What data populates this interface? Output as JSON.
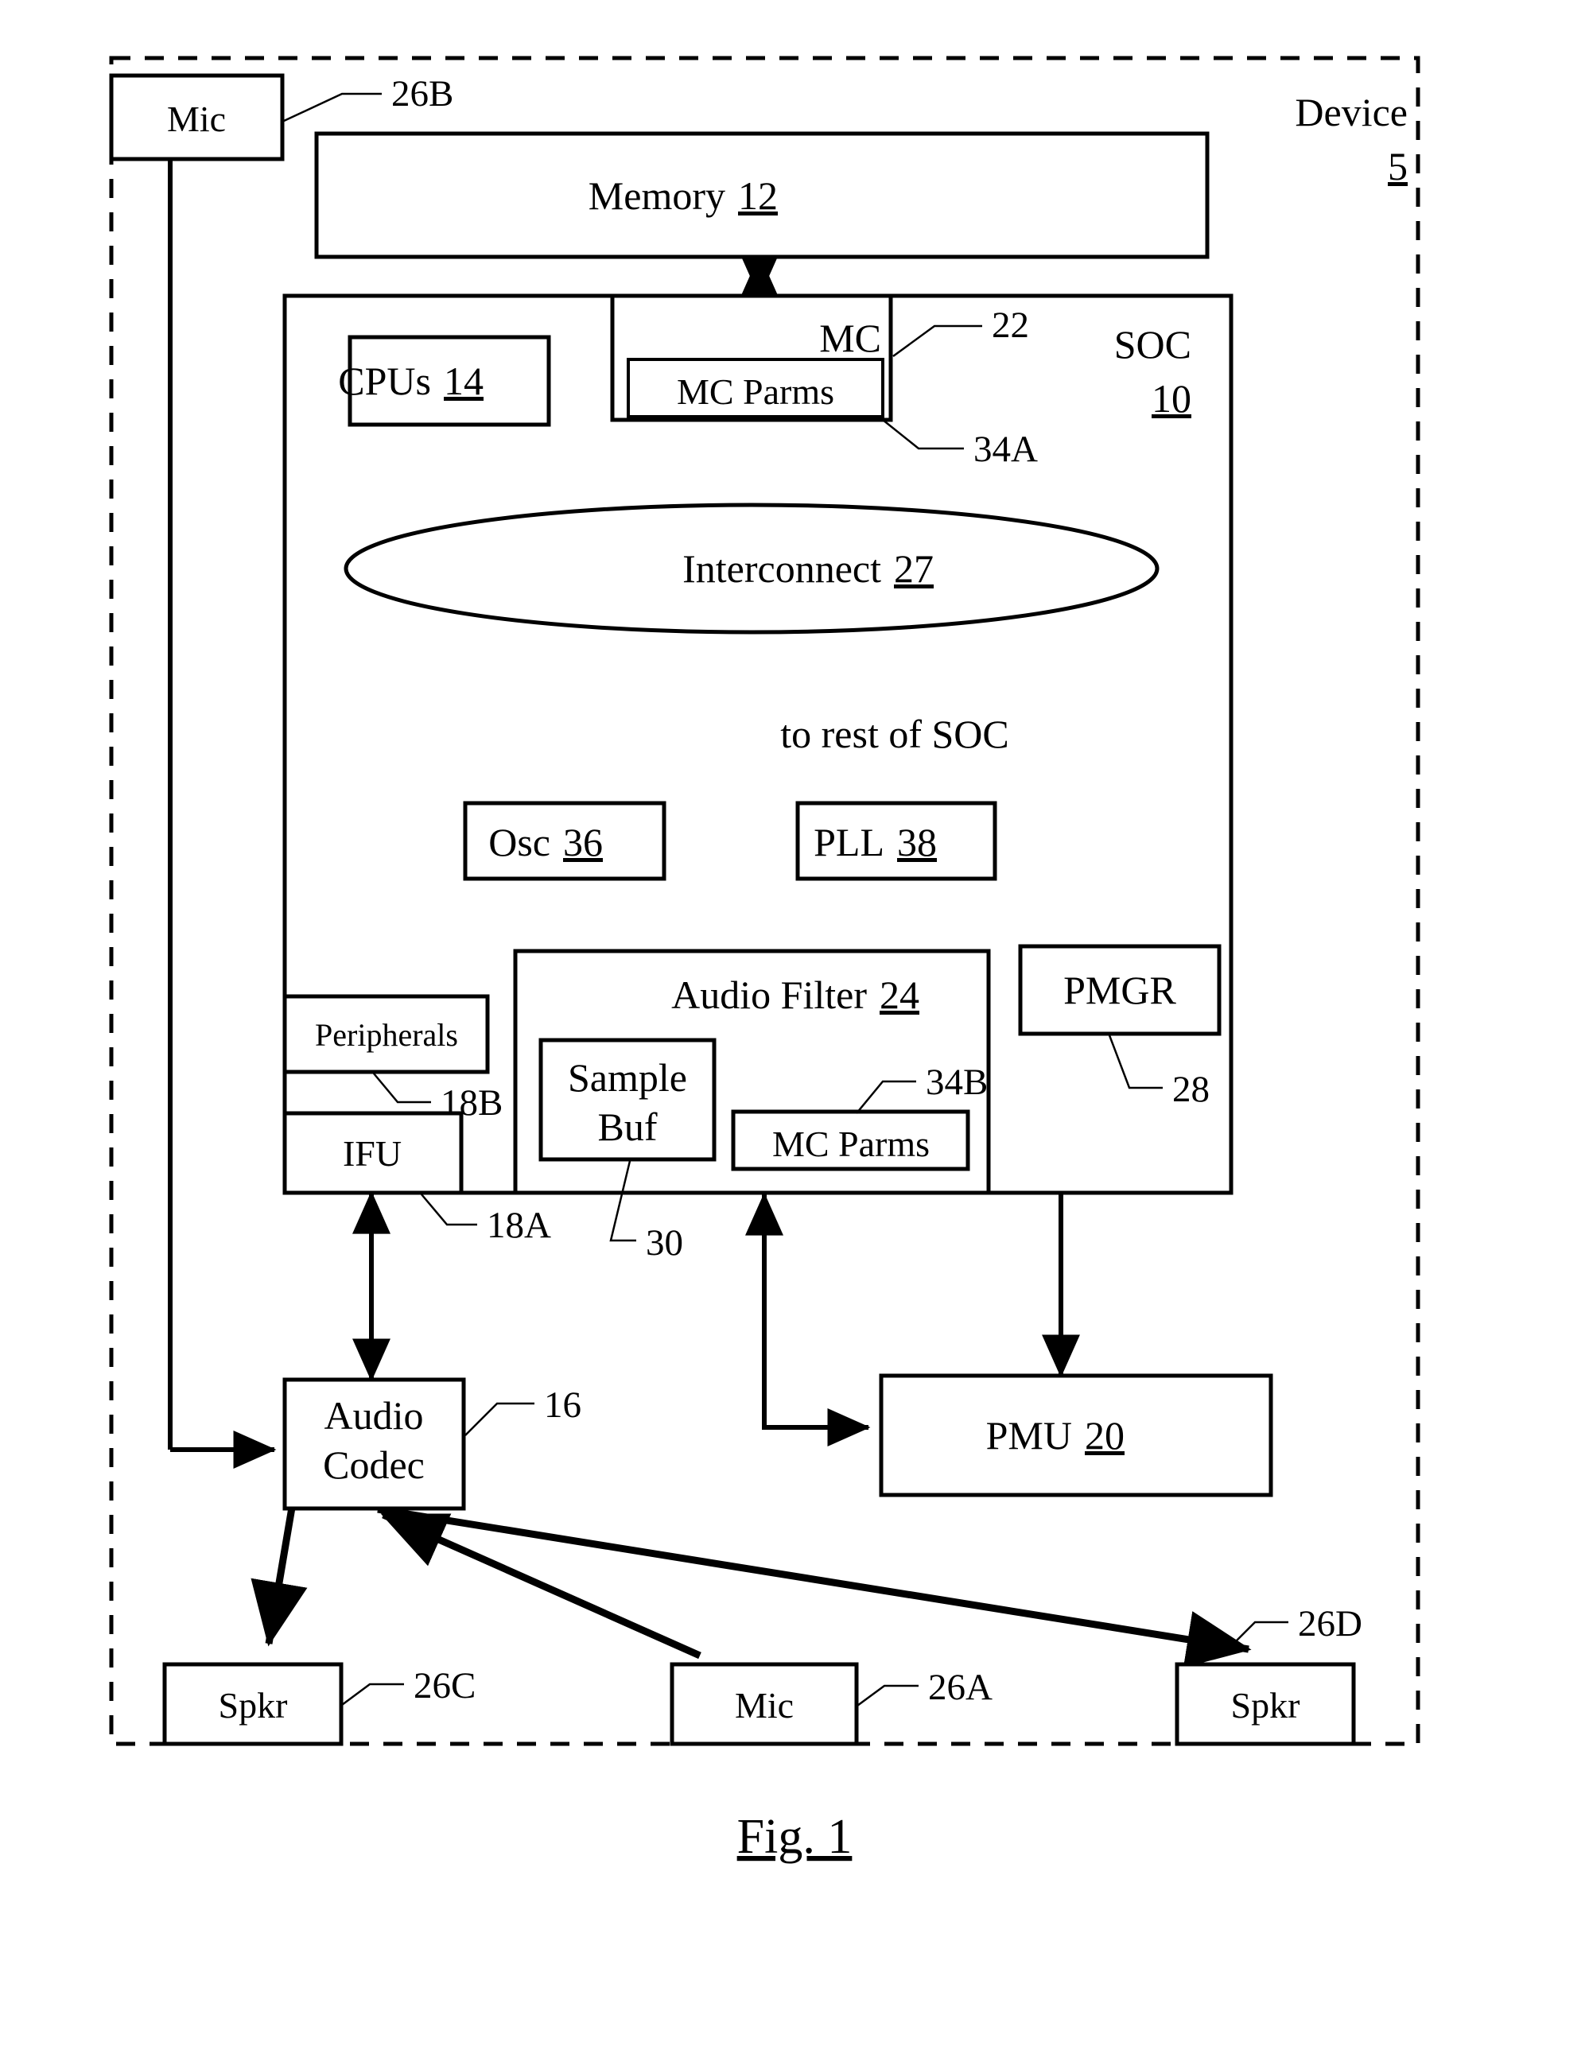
{
  "figure": {
    "caption": "Fig. 1",
    "device_label": "Device",
    "device_ref": "5"
  },
  "blocks": {
    "mic_top": {
      "label": "Mic",
      "ref": "26B"
    },
    "memory": {
      "label": "Memory",
      "ref": "12"
    },
    "soc": {
      "label": "SOC",
      "ref": "10"
    },
    "cpus": {
      "label": "CPUs",
      "ref": "14"
    },
    "mc": {
      "label": "MC",
      "ref": "22"
    },
    "mc_parms_a": {
      "label": "MC Parms",
      "ref": "34A"
    },
    "interconnect": {
      "label": "Interconnect",
      "ref": "27"
    },
    "osc": {
      "label": "Osc",
      "ref": "36"
    },
    "pll": {
      "label": "PLL",
      "ref": "38"
    },
    "to_rest_of_soc": {
      "label": "to rest of SOC"
    },
    "peripherals": {
      "label": "Peripherals",
      "ref": "18B"
    },
    "ifu": {
      "label": "IFU",
      "ref": "18A"
    },
    "audio_filter": {
      "label": "Audio Filter",
      "ref": "24"
    },
    "sample_buf": {
      "label_line1": "Sample",
      "label_line2": "Buf",
      "ref": "30"
    },
    "mc_parms_b": {
      "label": "MC Parms",
      "ref": "34B"
    },
    "pmgr": {
      "label": "PMGR",
      "ref": "28"
    },
    "pmu": {
      "label": "PMU",
      "ref": "20"
    },
    "audio_codec": {
      "label_line1": "Audio",
      "label_line2": "Codec",
      "ref": "16"
    },
    "spkr_left": {
      "label": "Spkr",
      "ref": "26C"
    },
    "mic_bottom": {
      "label": "Mic",
      "ref": "26A"
    },
    "spkr_right": {
      "label": "Spkr",
      "ref": "26D"
    }
  },
  "colors": {
    "stroke": "#000000",
    "fill": "#ffffff"
  }
}
